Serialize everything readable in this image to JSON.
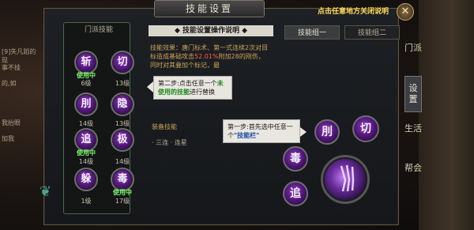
{
  "background_text": {
    "line1": "[9]失凡蹈的现",
    "line2": "事不挂",
    "line3": "的,如",
    "line4": "我抬眼",
    "line5": "加我"
  },
  "header": {
    "title": "技能设置",
    "hint": "点击任意地方关闭说明",
    "close_label": "✕"
  },
  "left_panel": {
    "heading": "门派技能",
    "skills": [
      {
        "glyph": "斩",
        "level": "6级",
        "used": "使用中"
      },
      {
        "glyph": "切",
        "level": "13级",
        "used": ""
      },
      {
        "glyph": "刖",
        "level": "14级",
        "used": ""
      },
      {
        "glyph": "隐",
        "level": "13级",
        "used": ""
      },
      {
        "glyph": "追",
        "level": "14级",
        "used": "使用中"
      },
      {
        "glyph": "极",
        "level": "14级",
        "used": ""
      },
      {
        "glyph": "躲",
        "level": "1级",
        "used": ""
      },
      {
        "glyph": "毒",
        "level": "17级",
        "used": "使用中"
      }
    ]
  },
  "info": {
    "title": "◆ 技能设置操作说明 ◆",
    "desc_prefix": "技能效果：唐门标术、第一式连续2次对目标造成基础攻击",
    "desc_hl": "52.01%",
    "desc_suffix": "附加28的刚伤，同时对其叠加个标记，最",
    "equip_title": "装备技能",
    "equip_line": "· 三连 · 连星"
  },
  "tabs": {
    "group1": "技能组一",
    "group2": "技能组二"
  },
  "side_tabs": [
    "门派",
    "设置",
    "生活",
    "帮会"
  ],
  "tips": {
    "step2_a": "第二步:点击任意一个",
    "step2_b": "未使用的技能",
    "step2_c": "进行替换",
    "step1_a": "第一步:首先选中任意一个",
    "step1_b": "\"技能栏\""
  },
  "right_skills": {
    "top_left": "刖",
    "top_right": "切",
    "mid": "毒",
    "bottom": "追"
  }
}
